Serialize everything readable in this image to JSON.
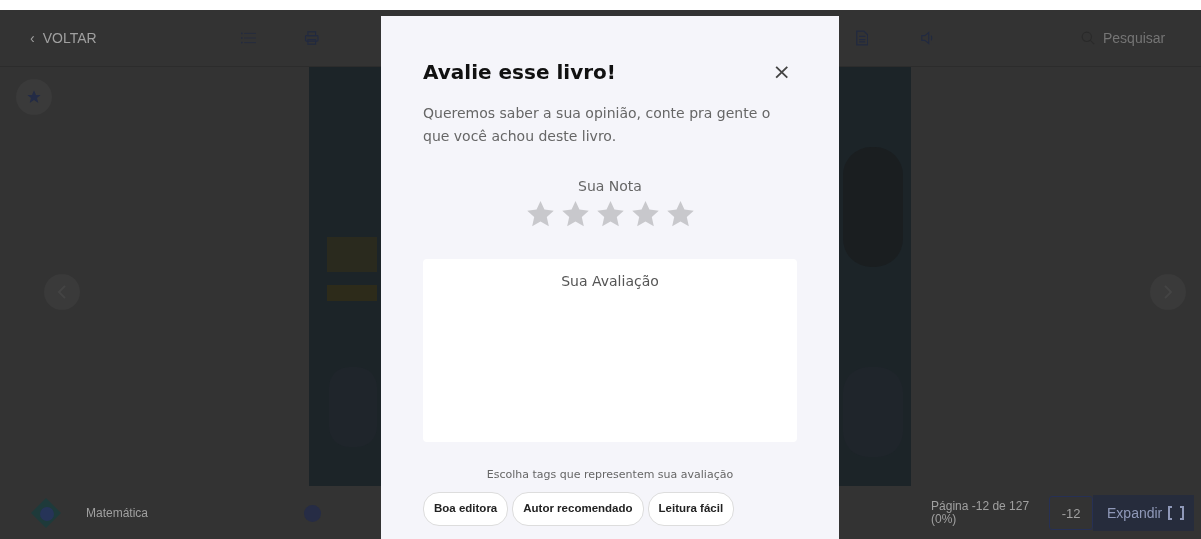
{
  "toolbar": {
    "back_label": "VOLTAR",
    "back_chevron": "‹",
    "search": {
      "placeholder": "Pesquisar"
    }
  },
  "footer": {
    "subject": "Matemática",
    "page_info": "Página -12 de 127 (0%)",
    "page_input": "-12",
    "expand_label": "Expandir"
  },
  "modal": {
    "title": "Avalie esse livro!",
    "close": "×",
    "intro": "Queremos saber a sua opinião, conte pra gente o que você achou deste livro.",
    "rating_label": "Sua Nota",
    "stars": 0,
    "review": {
      "placeholder": "Sua Avaliação"
    },
    "tags_hint": "Escolha tags que representem sua avaliação",
    "tags": [
      {
        "label": "Boa editora",
        "selected": false
      },
      {
        "label": "Autor recomendado",
        "selected": false
      },
      {
        "label": "Leitura fácil",
        "selected": false
      }
    ]
  }
}
